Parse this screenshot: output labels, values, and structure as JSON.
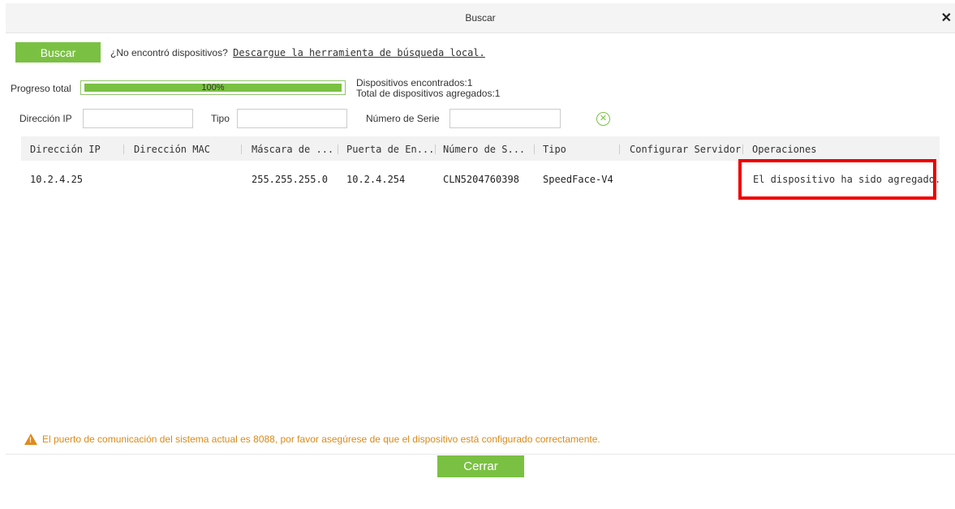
{
  "dialog": {
    "title": "Buscar"
  },
  "toolbar": {
    "search_label": "Buscar",
    "hint_text": "¿No encontró dispositivos?",
    "hint_link": "Descargue la herramienta de búsqueda local."
  },
  "progress": {
    "label": "Progreso total",
    "value": 100,
    "text": "100%"
  },
  "counts": {
    "found": "Dispositivos encontrados:1",
    "added": "Total de dispositivos agregados:1"
  },
  "filters": {
    "ip_label": "Dirección IP",
    "type_label": "Tipo",
    "serial_label": "Número de Serie"
  },
  "table": {
    "columns": [
      "Dirección IP",
      "Dirección MAC",
      "Máscara de ...",
      "Puerta de En...",
      "Número de S...",
      "Tipo",
      "Configurar Servidor",
      "Operaciones"
    ],
    "rows": [
      {
        "ip": "10.2.4.25",
        "mac": "",
        "mask": "255.255.255.0",
        "gateway": "10.2.4.254",
        "serial": "CLN5204760398",
        "type": "SpeedFace-V4",
        "server": "",
        "operation": "El dispositivo ha sido agregado."
      }
    ]
  },
  "footer": {
    "warning": "El puerto de comunicación del sistema actual es 8088, por favor asegúrese de que el dispositivo está configurado correctamente.",
    "close_label": "Cerrar"
  },
  "colors": {
    "accent": "#7ac143",
    "warning": "#d98a1a",
    "highlight": "#ee0000"
  }
}
